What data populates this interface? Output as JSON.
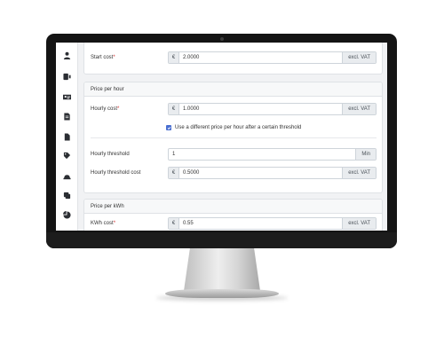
{
  "start_cost": {
    "label": "Start cost",
    "required_mark": "*",
    "currency": "€",
    "value": "2.0000",
    "suffix": "excl. VAT"
  },
  "price_per_hour": {
    "title": "Price per hour",
    "hourly_cost": {
      "label": "Hourly cost",
      "required_mark": "*",
      "currency": "€",
      "value": "1.0000",
      "suffix": "excl. VAT"
    },
    "different_price_checkbox": {
      "label": "Use a different price per hour after a certain threshold",
      "checked": true
    },
    "hourly_threshold": {
      "label": "Hourly threshold",
      "value": "1",
      "suffix": "Min"
    },
    "hourly_threshold_cost": {
      "label": "Hourly threshold cost",
      "currency": "€",
      "value": "0.5000",
      "suffix": "excl. VAT"
    }
  },
  "price_per_kwh": {
    "title": "Price per kWh",
    "kwh_cost": {
      "label": "KWh cost",
      "required_mark": "*",
      "currency": "€",
      "value": "0.55",
      "suffix": "excl. VAT"
    }
  },
  "sidebar": {
    "icons": [
      "user-icon",
      "badge-icon",
      "id-card-icon",
      "document-icon",
      "file-icon",
      "tag-icon",
      "car-icon",
      "database-icon",
      "chart-icon"
    ]
  },
  "colors": {
    "accent": "#4a6fd1",
    "required": "#d32f2f",
    "bezel": "#141414"
  }
}
